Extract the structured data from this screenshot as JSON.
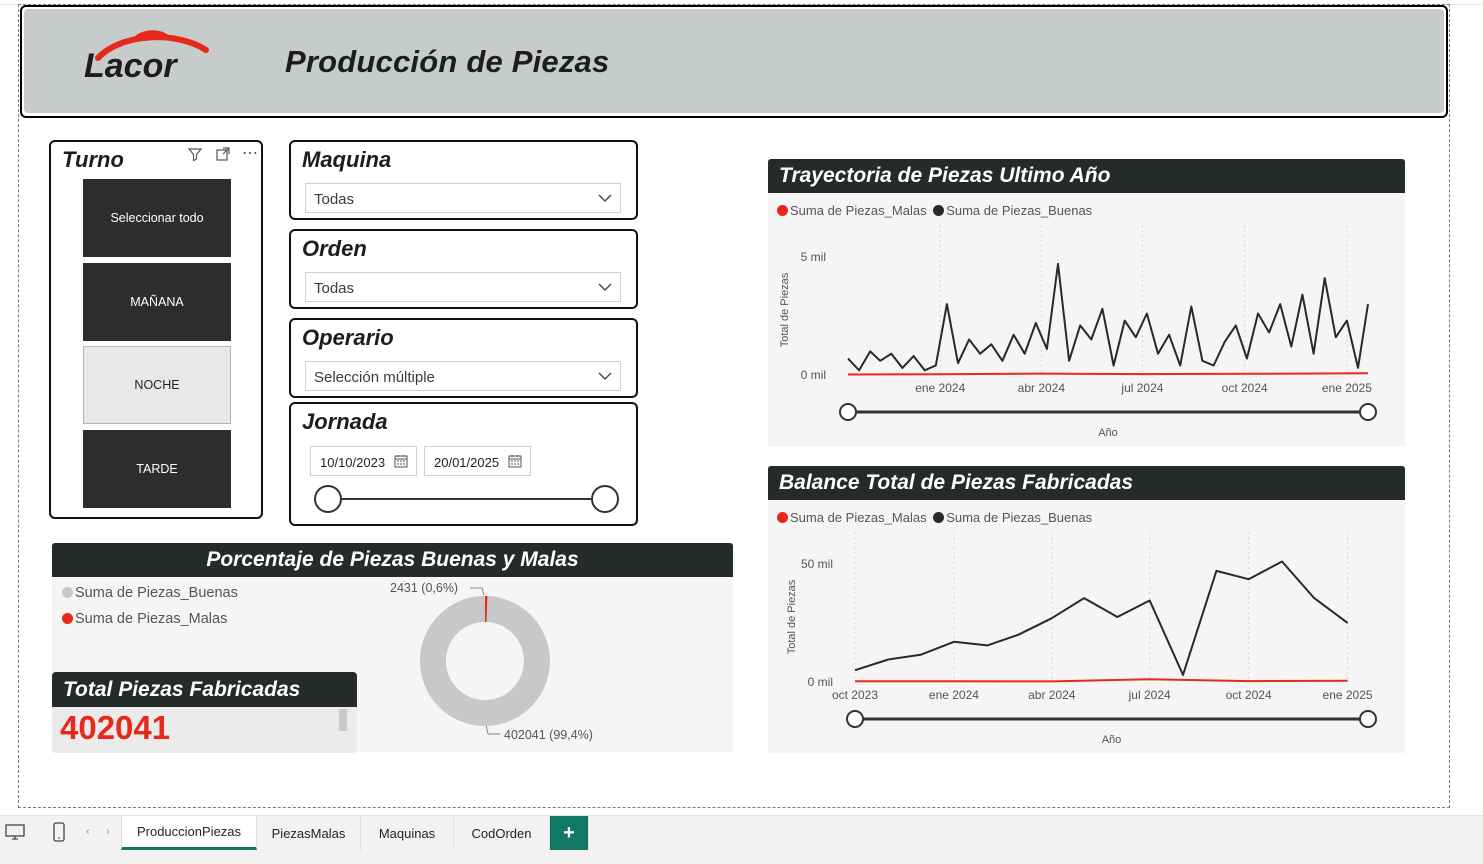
{
  "header": {
    "title": "Producción de Piezas",
    "logo_text": "Lacor"
  },
  "turno": {
    "title": "Turno",
    "items": [
      {
        "label": "Seleccionar todo",
        "selected": true
      },
      {
        "label": "MAÑANA",
        "selected": true
      },
      {
        "label": "NOCHE",
        "selected": false
      },
      {
        "label": "TARDE",
        "selected": true
      }
    ]
  },
  "maquina": {
    "title": "Maquina",
    "value": "Todas"
  },
  "orden": {
    "title": "Orden",
    "value": "Todas"
  },
  "operario": {
    "title": "Operario",
    "value": "Selección múltiple"
  },
  "jornada": {
    "title": "Jornada",
    "start": "10/10/2023",
    "end": "20/01/2025"
  },
  "donut": {
    "title": "Porcentaje de Piezas Buenas y Malas",
    "legend": [
      "Suma de Piezas_Buenas",
      "Suma de Piezas_Malas"
    ],
    "label_malas": "2431 (0,6%)",
    "label_buenas": "402041 (99,4%)"
  },
  "total_card": {
    "title": "Total Piezas Fabricadas",
    "value": "402041"
  },
  "colors": {
    "buenas": "#252b2a",
    "malas": "#e8281a",
    "donut_buenas": "#c8c8c8",
    "header_bar": "#252b2a",
    "accent": "#117865"
  },
  "chart1": {
    "title": "Trayectoria de Piezas Ultimo Año",
    "legend": [
      "Suma de Piezas_Malas",
      "Suma de Piezas_Buenas"
    ]
  },
  "chart2": {
    "title": "Balance Total de Piezas Fabricadas",
    "legend": [
      "Suma de Piezas_Malas",
      "Suma de Piezas_Buenas"
    ]
  },
  "chart_data": [
    {
      "type": "line",
      "title": "Trayectoria de Piezas Ultimo Año",
      "xlabel": "Año",
      "ylabel": "Total de Piezas",
      "y_ticks": [
        "0 mil",
        "5 mil"
      ],
      "x_ticks": [
        "ene 2024",
        "abr 2024",
        "jul 2024",
        "oct 2024",
        "ene 2025"
      ],
      "ylim": [
        0,
        5500
      ],
      "xlim": [
        "2023-10-10",
        "2025-01-20"
      ],
      "legend_position": "top-left",
      "grid": true,
      "series": [
        {
          "name": "Suma de Piezas_Buenas",
          "color": "#252b2a",
          "x": [
            "2023-10-10",
            "2023-10-20",
            "2023-10-30",
            "2023-11-08",
            "2023-11-18",
            "2023-11-28",
            "2023-12-08",
            "2023-12-18",
            "2023-12-28",
            "2024-01-07",
            "2024-01-17",
            "2024-01-27",
            "2024-02-06",
            "2024-02-16",
            "2024-02-26",
            "2024-03-07",
            "2024-03-17",
            "2024-03-27",
            "2024-04-06",
            "2024-04-16",
            "2024-04-26",
            "2024-05-06",
            "2024-05-16",
            "2024-05-26",
            "2024-06-05",
            "2024-06-15",
            "2024-06-25",
            "2024-07-05",
            "2024-07-15",
            "2024-07-25",
            "2024-08-04",
            "2024-08-14",
            "2024-08-24",
            "2024-09-03",
            "2024-09-13",
            "2024-09-23",
            "2024-10-03",
            "2024-10-13",
            "2024-10-23",
            "2024-11-02",
            "2024-11-12",
            "2024-11-22",
            "2024-12-02",
            "2024-12-12",
            "2024-12-22",
            "2025-01-01",
            "2025-01-11",
            "2025-01-20"
          ],
          "values": [
            700,
            200,
            1000,
            600,
            900,
            300,
            800,
            200,
            400,
            3000,
            500,
            1500,
            900,
            1300,
            600,
            1700,
            900,
            2200,
            1100,
            4700,
            600,
            2100,
            1500,
            2800,
            400,
            2300,
            1600,
            2600,
            900,
            1700,
            400,
            2900,
            600,
            400,
            1400,
            2100,
            700,
            2600,
            1800,
            3000,
            1200,
            3400,
            900,
            4100,
            1600,
            2300,
            300,
            3000
          ]
        },
        {
          "name": "Suma de Piezas_Malas",
          "color": "#e8281a",
          "x": [
            "2023-10-10",
            "2024-01-01",
            "2024-04-01",
            "2024-07-01",
            "2024-10-01",
            "2025-01-20"
          ],
          "values": [
            20,
            30,
            60,
            40,
            50,
            70
          ]
        }
      ]
    },
    {
      "type": "line",
      "title": "Balance Total de Piezas Fabricadas",
      "xlabel": "Año",
      "ylabel": "Total de Piezas",
      "y_ticks": [
        "0 mil",
        "50 mil"
      ],
      "x_ticks": [
        "oct 2023",
        "ene 2024",
        "abr 2024",
        "jul 2024",
        "oct 2024",
        "ene 2025"
      ],
      "ylim": [
        0,
        55000
      ],
      "xlim": [
        "2023-10-01",
        "2025-01-20"
      ],
      "legend_position": "top-left",
      "grid": true,
      "series": [
        {
          "name": "Suma de Piezas_Buenas",
          "color": "#252b2a",
          "x": [
            "2023-10-01",
            "2023-11-01",
            "2023-12-01",
            "2024-01-01",
            "2024-02-01",
            "2024-03-01",
            "2024-04-01",
            "2024-05-01",
            "2024-06-01",
            "2024-07-01",
            "2024-08-01",
            "2024-09-01",
            "2024-10-01",
            "2024-11-01",
            "2024-12-01",
            "2025-01-01"
          ],
          "values": [
            5000,
            9500,
            11500,
            17000,
            15500,
            20000,
            27000,
            35500,
            27500,
            34500,
            3000,
            47000,
            43500,
            51000,
            35500,
            25000
          ]
        },
        {
          "name": "Suma de Piezas_Malas",
          "color": "#e8281a",
          "x": [
            "2023-10-01",
            "2024-01-01",
            "2024-04-01",
            "2024-07-01",
            "2024-10-01",
            "2025-01-01"
          ],
          "values": [
            300,
            300,
            250,
            1200,
            400,
            500
          ]
        }
      ]
    },
    {
      "type": "pie",
      "title": "Porcentaje de Piezas Buenas y Malas",
      "categories": [
        "Suma de Piezas_Buenas",
        "Suma de Piezas_Malas"
      ],
      "values": [
        402041,
        2431
      ],
      "labels": [
        "402041 (99,4%)",
        "2431 (0,6%)"
      ],
      "legend_position": "top-left"
    }
  ],
  "tabs": [
    "ProduccionPiezas",
    "PiezasMalas",
    "Maquinas",
    "CodOrden"
  ],
  "tab_add": "+"
}
